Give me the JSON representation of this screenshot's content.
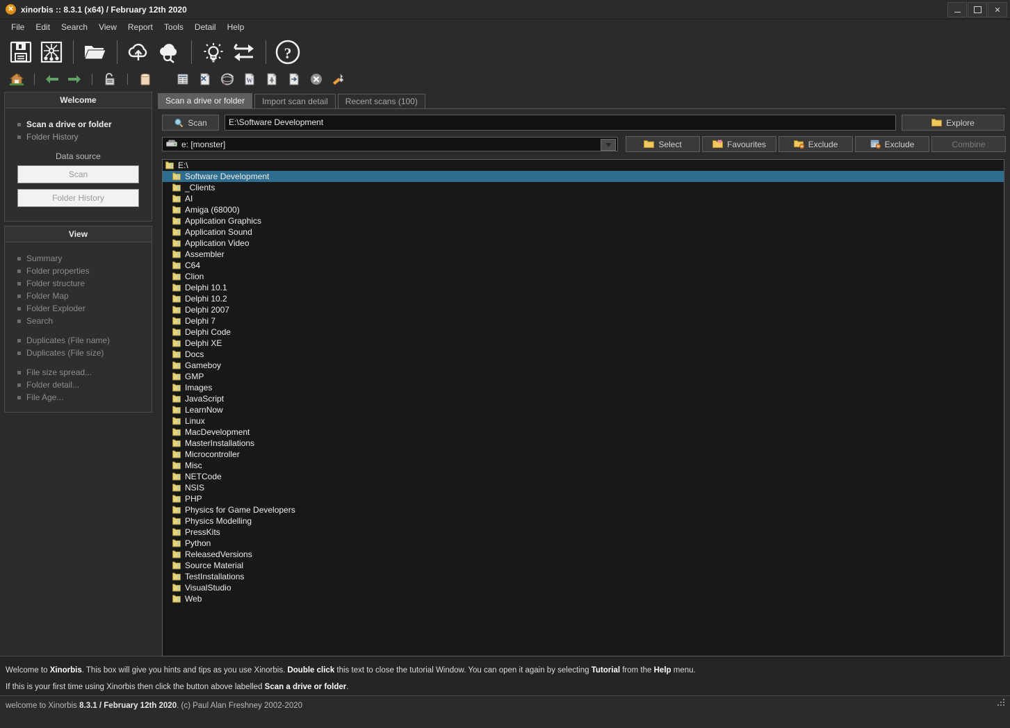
{
  "window": {
    "title": "xinorbis :: 8.3.1 (x64) / February 12th 2020",
    "app_icon": "xinorbis-x-icon",
    "controls": {
      "minimize": "minimize-icon",
      "maximize": "maximize-icon",
      "close": "✕"
    }
  },
  "menu": [
    "File",
    "Edit",
    "Search",
    "View",
    "Report",
    "Tools",
    "Detail",
    "Help"
  ],
  "toolbar_primary": [
    {
      "name": "save-icon"
    },
    {
      "name": "scan-image-icon"
    },
    {
      "sep": true
    },
    {
      "name": "open-folder-icon"
    },
    {
      "sep": true
    },
    {
      "name": "cloud-upload-icon"
    },
    {
      "name": "cloud-search-icon"
    },
    {
      "sep": true
    },
    {
      "name": "lightbulb-icon"
    },
    {
      "name": "refresh-swap-icon"
    },
    {
      "sep": true
    },
    {
      "name": "help-icon"
    }
  ],
  "toolbar_secondary": [
    {
      "name": "home-icon"
    },
    {
      "sep": true
    },
    {
      "name": "back-arrow-icon"
    },
    {
      "name": "forward-arrow-icon"
    },
    {
      "sep": true
    },
    {
      "name": "unlock-icon"
    },
    {
      "sep": true
    },
    {
      "name": "database-icon"
    },
    {
      "gap": true
    },
    {
      "name": "report-grid-icon"
    },
    {
      "name": "report-xml-icon"
    },
    {
      "name": "report-html-icon"
    },
    {
      "name": "report-word-icon"
    },
    {
      "name": "report-tree-icon"
    },
    {
      "name": "report-csv-icon"
    },
    {
      "name": "close-report-icon"
    },
    {
      "name": "wrench-icon"
    }
  ],
  "sidebar": {
    "welcome": {
      "header": "Welcome",
      "items": [
        {
          "label": "Scan a drive or folder",
          "active": true
        },
        {
          "label": "Folder History",
          "active": false
        }
      ],
      "data_source_label": "Data source",
      "buttons": [
        "Scan",
        "Folder History"
      ]
    },
    "view": {
      "header": "View",
      "group1": [
        "Summary",
        "Folder properties",
        "Folder structure",
        "Folder Map",
        "Folder Exploder",
        "Search"
      ],
      "group2": [
        "Duplicates (File name)",
        "Duplicates (File size)"
      ],
      "group3": [
        "File size spread...",
        "Folder detail...",
        "File Age..."
      ]
    }
  },
  "tabs": [
    {
      "label": "Scan a drive or folder",
      "selected": true
    },
    {
      "label": "Import scan detail",
      "selected": false
    },
    {
      "label": "Recent scans (100)",
      "selected": false
    }
  ],
  "scan_row": {
    "scan_button": "Scan",
    "scan_icon": "magnifier-icon",
    "path_value": "E:\\Software Development",
    "explore_button": "Explore",
    "explore_icon": "folder-icon"
  },
  "drive_row": {
    "drive_icon": "drive-icon",
    "drive_value": "e: [monster]",
    "dropdown_icon": "chevron-down-icon",
    "buttons": [
      {
        "label": "Select",
        "icon": "folder-icon",
        "disabled": false
      },
      {
        "label": "Favourites",
        "icon": "folder-heart-icon",
        "disabled": false
      },
      {
        "label": "Exclude",
        "icon": "folder-exclude-icon",
        "disabled": false
      },
      {
        "label": "Exclude",
        "icon": "file-exclude-icon",
        "disabled": false
      },
      {
        "label": "Combine",
        "icon": "none",
        "disabled": true
      }
    ]
  },
  "tree": {
    "root": "E:\\",
    "items": [
      {
        "label": "Software Development",
        "selected": true
      },
      {
        "label": "_Clients",
        "selected": false
      },
      {
        "label": "AI",
        "selected": false
      },
      {
        "label": "Amiga (68000)",
        "selected": false
      },
      {
        "label": "Application Graphics",
        "selected": false
      },
      {
        "label": "Application Sound",
        "selected": false
      },
      {
        "label": "Application Video",
        "selected": false
      },
      {
        "label": "Assembler",
        "selected": false
      },
      {
        "label": "C64",
        "selected": false
      },
      {
        "label": "Clion",
        "selected": false
      },
      {
        "label": "Delphi 10.1",
        "selected": false
      },
      {
        "label": "Delphi 10.2",
        "selected": false
      },
      {
        "label": "Delphi 2007",
        "selected": false
      },
      {
        "label": "Delphi 7",
        "selected": false
      },
      {
        "label": "Delphi Code",
        "selected": false
      },
      {
        "label": "Delphi XE",
        "selected": false
      },
      {
        "label": "Docs",
        "selected": false
      },
      {
        "label": "Gameboy",
        "selected": false
      },
      {
        "label": "GMP",
        "selected": false
      },
      {
        "label": "Images",
        "selected": false
      },
      {
        "label": "JavaScript",
        "selected": false
      },
      {
        "label": "LearnNow",
        "selected": false
      },
      {
        "label": "Linux",
        "selected": false
      },
      {
        "label": "MacDevelopment",
        "selected": false
      },
      {
        "label": "MasterInstallations",
        "selected": false
      },
      {
        "label": "Microcontroller",
        "selected": false
      },
      {
        "label": "Misc",
        "selected": false
      },
      {
        "label": "NETCode",
        "selected": false
      },
      {
        "label": "NSIS",
        "selected": false
      },
      {
        "label": "PHP",
        "selected": false
      },
      {
        "label": "Physics for Game Developers",
        "selected": false
      },
      {
        "label": "Physics Modelling",
        "selected": false
      },
      {
        "label": "PressKits",
        "selected": false
      },
      {
        "label": "Python",
        "selected": false
      },
      {
        "label": "ReleasedVersions",
        "selected": false
      },
      {
        "label": "Source Material",
        "selected": false
      },
      {
        "label": "TestInstallations",
        "selected": false
      },
      {
        "label": "VisualStudio",
        "selected": false
      },
      {
        "label": "Web",
        "selected": false
      }
    ]
  },
  "tutorial": {
    "line1_parts": [
      {
        "t": "Welcome to ",
        "b": false
      },
      {
        "t": "Xinorbis",
        "b": true
      },
      {
        "t": ". This box will give you hints and tips as you use Xinorbis. ",
        "b": false
      },
      {
        "t": "Double click",
        "b": true
      },
      {
        "t": " this text to close the tutorial Window. You can open it again by selecting ",
        "b": false
      },
      {
        "t": "Tutorial",
        "b": true
      },
      {
        "t": " from the ",
        "b": false
      },
      {
        "t": "Help",
        "b": true
      },
      {
        "t": " menu.",
        "b": false
      }
    ],
    "line2_parts": [
      {
        "t": "If this is your first time using Xinorbis then click the button above labelled ",
        "b": false
      },
      {
        "t": "Scan a drive or folder",
        "b": true
      },
      {
        "t": ".",
        "b": false
      }
    ]
  },
  "status": {
    "parts": [
      {
        "t": "welcome to Xinorbis ",
        "b": false
      },
      {
        "t": "8.3.1 / February 12th 2020",
        "b": true
      },
      {
        "t": ". (c) Paul Alan Freshney 2002-2020",
        "b": false
      }
    ]
  },
  "colors": {
    "background": "#2b2b2b",
    "tree_background": "#181818",
    "selection": "#2e6d8e",
    "folder_yellow": "#e8d27a",
    "accent_orange": "#e08a18",
    "arrow_green": "#5f9e5f"
  }
}
